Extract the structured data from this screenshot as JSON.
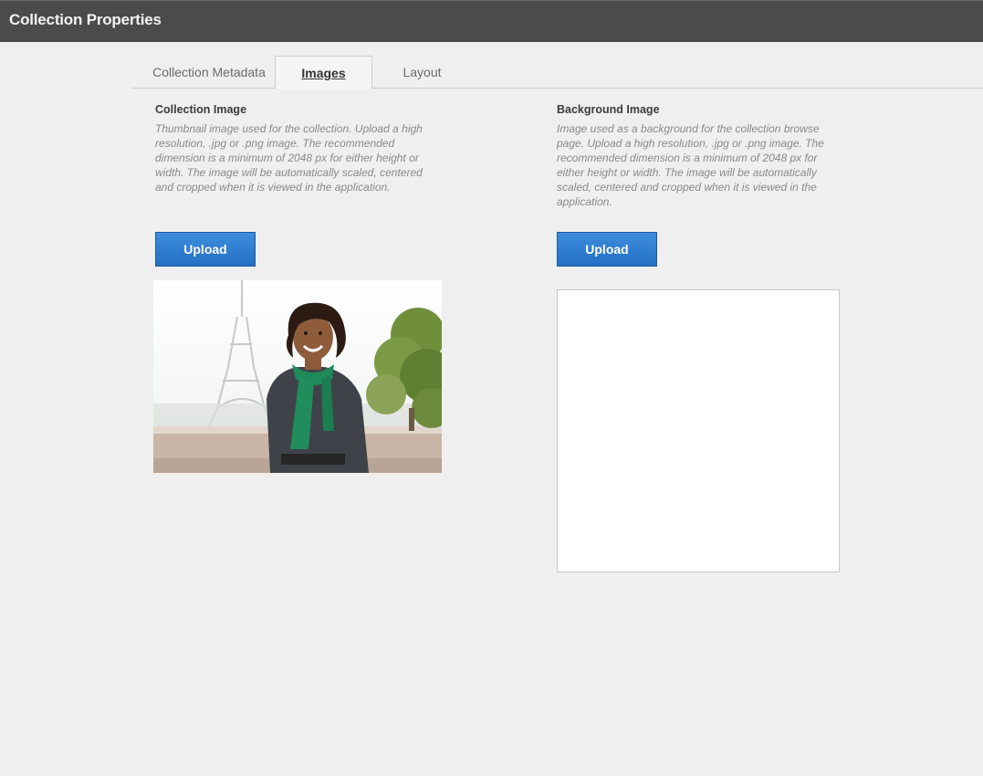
{
  "window": {
    "title": "Collection Properties"
  },
  "tabs": [
    {
      "label": "Collection Metadata",
      "active": false
    },
    {
      "label": "Images",
      "active": true
    },
    {
      "label": "Layout",
      "active": false
    }
  ],
  "collection_image": {
    "heading": "Collection Image",
    "description": "Thumbnail image used for the collection. Upload a high resolution, .jpg or .png image. The recommended dimension is a minimum of 2048 px for either height or width. The image will be automatically scaled, centered and cropped when it is viewed in the application.",
    "upload_label": "Upload"
  },
  "background_image": {
    "heading": "Background Image",
    "description": "Image used as a background for the collection browse page. Upload a high resolution, .jpg or .png image. The recommended dimension is a minimum of 2048 px for either height or width. The image will be automatically scaled, centered and cropped when it is viewed in the application.",
    "upload_label": "Upload"
  },
  "colors": {
    "titlebar": "#4b4b4b",
    "accent": "#2a78cc",
    "background": "#efefef"
  }
}
